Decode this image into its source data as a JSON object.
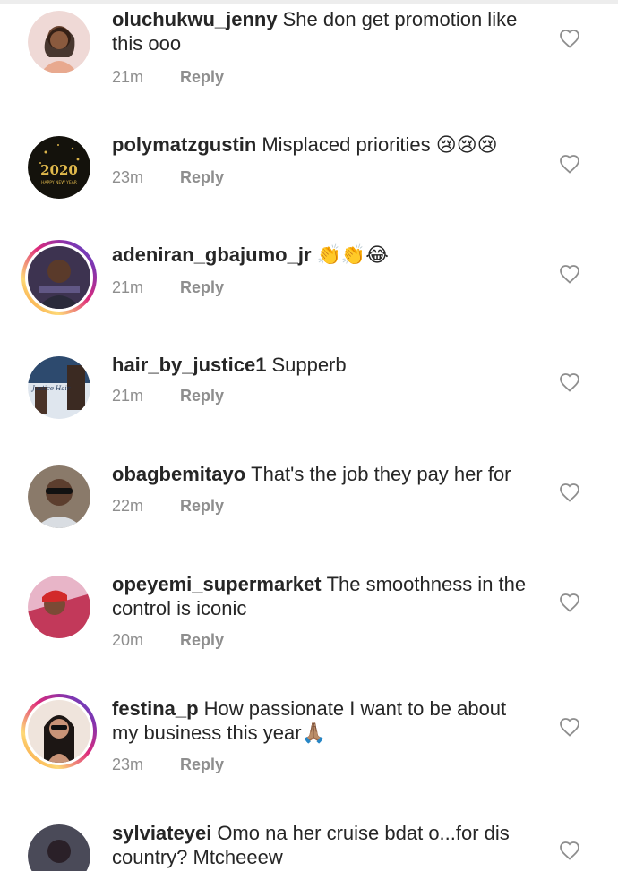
{
  "comments": [
    {
      "username": "oluchukwu_jenny",
      "text": "She don get promotion like this ooo",
      "time": "21m",
      "reply": "Reply",
      "avatar_color": "#e8c6c6",
      "ring": false
    },
    {
      "username": "polymatzgustin",
      "text": "Misplaced priorities",
      "emoji_suffix": "😢😢😢",
      "time": "23m",
      "reply": "Reply",
      "avatar_color": "#1b1a12",
      "avatar_text": "2020",
      "avatar_subtext": "HAPPY NEW YEAR",
      "ring": false
    },
    {
      "username": "adeniran_gbajumo_jr",
      "text": "👏👏😂",
      "time": "21m",
      "reply": "Reply",
      "avatar_color": "#3a2f4a",
      "ring": true
    },
    {
      "username": "hair_by_justice1",
      "text": "Supperb",
      "time": "21m",
      "reply": "Reply",
      "avatar_color": "#2f3e55",
      "avatar_text": "Justice Hair",
      "ring": false
    },
    {
      "username": "obagbemitayo",
      "text": "That's the job they pay her for",
      "time": "22m",
      "reply": "Reply",
      "avatar_color": "#6b5a4e",
      "ring": false
    },
    {
      "username": "opeyemi_supermarket",
      "text": "The smoothness in the control is iconic",
      "time": "20m",
      "reply": "Reply",
      "avatar_color": "#c94a4a",
      "ring": false
    },
    {
      "username": "festina_p",
      "text": "How passionate I want to be about my business this year🙏🏽",
      "time": "23m",
      "reply": "Reply",
      "avatar_color": "#d9b8a6",
      "ring": true
    },
    {
      "username": "sylviateyei",
      "text": "Omo na her cruise bdat o...for dis country? Mtcheeew",
      "time": "",
      "reply": "",
      "avatar_color": "#3b3b47",
      "ring": false
    }
  ],
  "colors": {
    "text": "#262626",
    "meta": "#8e8e8e",
    "heart_stroke": "#8e8e8e",
    "story_ring": "#dd2a7b"
  },
  "icons": {
    "like": "heart-outline-icon"
  }
}
